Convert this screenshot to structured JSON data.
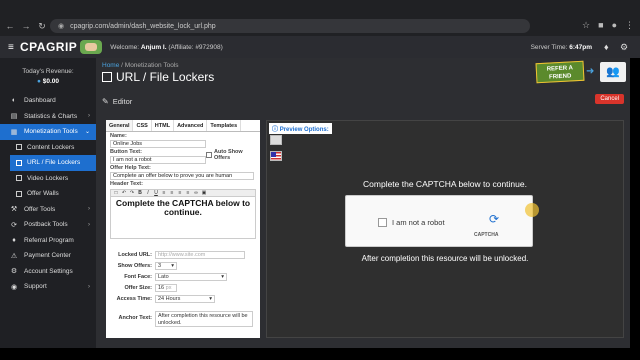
{
  "browser": {
    "url": "cpagrip.com/admin/dash_website_lock_url.php"
  },
  "header": {
    "logo": "CPAGRIP",
    "welcome_prefix": "Welcome:",
    "user_name": "Anjum I.",
    "affiliate": "(Affiliate: #972908)",
    "server_time_label": "Server Time:",
    "server_time": "6:47pm"
  },
  "sidebar": {
    "revenue_label": "Today's Revenue:",
    "revenue_value": "$0.00",
    "items": [
      {
        "label": "Dashboard",
        "icon": "dashboard-icon"
      },
      {
        "label": "Statistics & Charts",
        "icon": "chart-icon"
      },
      {
        "label": "Monetization Tools",
        "icon": "tools-icon"
      },
      {
        "label": "Content Lockers",
        "icon": "lock-icon"
      },
      {
        "label": "URL / File Lockers",
        "icon": "link-icon"
      },
      {
        "label": "Video Lockers",
        "icon": "video-icon"
      },
      {
        "label": "Offer Walls",
        "icon": "wall-icon"
      },
      {
        "label": "Offer Tools",
        "icon": "wrench-icon"
      },
      {
        "label": "Postback Tools",
        "icon": "postback-icon"
      },
      {
        "label": "Referral Program",
        "icon": "referral-icon"
      },
      {
        "label": "Payment Center",
        "icon": "payment-icon"
      },
      {
        "label": "Account Settings",
        "icon": "settings-icon"
      },
      {
        "label": "Support",
        "icon": "support-icon"
      }
    ]
  },
  "main": {
    "breadcrumb_home": "Home",
    "breadcrumb_section": "Monetization Tools",
    "title": "URL / File Lockers",
    "banner_text": "REFER A FRIEND",
    "editor_label": "Editor",
    "cancel_label": "Cancel"
  },
  "editor": {
    "tabs": [
      "General",
      "CSS",
      "HTML",
      "Advanced",
      "Templates"
    ],
    "name_label": "Name:",
    "name_value": "Online Jobs",
    "button_text_label": "Button Text:",
    "button_text_value": "I am not a robot",
    "auto_show_label": "Auto Show Offers",
    "offer_help_label": "Offer Help Text:",
    "offer_help_value": "Complete an offer below to prove you are human",
    "header_text_label": "Header Text:",
    "header_text_value": "Complete the CAPTCHA below to continue.",
    "locked_url_label": "Locked URL:",
    "locked_url_placeholder": "http://www.site.com",
    "show_offers_label": "Show Offers:",
    "show_offers_value": "3",
    "font_face_label": "Font Face:",
    "font_face_value": "Lato",
    "offer_size_label": "Offer Size:",
    "offer_size_value": "16",
    "offer_size_unit": "px",
    "access_time_label": "Access Time:",
    "access_time_value": "24 Hours",
    "anchor_text_label": "Anchor Text:",
    "anchor_text_value": "After completion this resource will be unlocked."
  },
  "preview": {
    "options_label": "Preview Options:",
    "heading": "Complete the CAPTCHA below to continue.",
    "captcha_label": "I am not a robot",
    "captcha_brand": "CAPTCHA",
    "after_text": "After completion this resource will be unlocked."
  }
}
